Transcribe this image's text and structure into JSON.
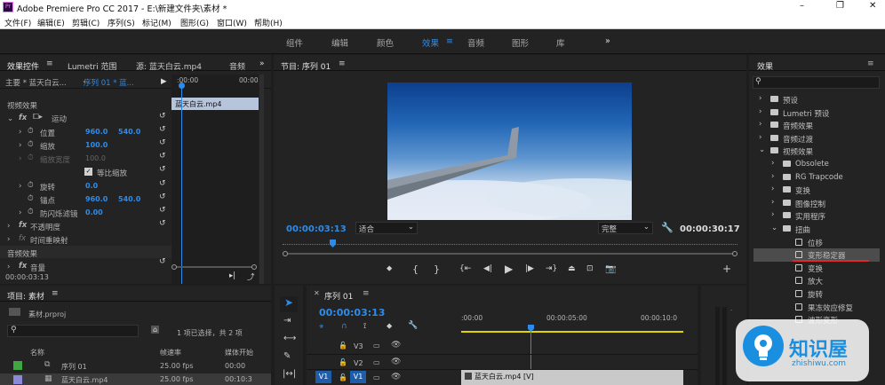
{
  "app": {
    "title": "Adobe Premiere Pro CC 2017 - E:\\新建文件夹\\素材 *"
  },
  "window_controls": {
    "minimize": "–",
    "restore": "❐",
    "close": "✕"
  },
  "menu": [
    "文件(F)",
    "编辑(E)",
    "剪辑(C)",
    "序列(S)",
    "标记(M)",
    "图形(G)",
    "窗口(W)",
    "帮助(H)"
  ],
  "workspaces": {
    "items": [
      "组件",
      "编辑",
      "颜色",
      "效果",
      "音频",
      "图形",
      "库"
    ],
    "active": "效果",
    "more": "»"
  },
  "effect_controls": {
    "tabs": [
      "效果控件",
      "Lumetri 范围",
      "源: 蓝天白云.mp4",
      "音频"
    ],
    "master": "主要 * 蓝天白云...",
    "sequence": "序列 01 * 蓝...",
    "clip_bar": "蓝天白云.mp4",
    "ruler_start": ":00:00",
    "ruler_end": "00:00",
    "video_effects": "视频效果",
    "motion": "运动",
    "position": {
      "label": "位置",
      "x": "960.0",
      "y": "540.0"
    },
    "scale": {
      "label": "缩放",
      "value": "100.0"
    },
    "scale_width": {
      "label": "缩放宽度",
      "value": "100.0"
    },
    "uniform_scale": "等比缩放",
    "rotation": {
      "label": "旋转",
      "value": "0.0"
    },
    "anchor": {
      "label": "锚点",
      "x": "960.0",
      "y": "540.0"
    },
    "antiflicker": {
      "label": "防闪烁滤镜",
      "value": "0.00"
    },
    "opacity": "不透明度",
    "time_remap": "时间重映射",
    "audio_effects": "音频效果",
    "volume": "音量",
    "timecode": "00:00:03:13"
  },
  "program": {
    "title": "节目: 序列 01",
    "timecode": "00:00:03:13",
    "fit": "适合",
    "quality": "完整",
    "duration": "00:00:30:17"
  },
  "project": {
    "title": "项目: 素材",
    "file": "素材.prproj",
    "selection": "1 项已选择，共 2 项",
    "columns": [
      "名称",
      "帧速率",
      "媒体开始"
    ],
    "items": [
      {
        "name": "序列 01",
        "fps": "25.00 fps",
        "start": "00:00",
        "color": "#3fa73f"
      },
      {
        "name": "蓝天白云.mp4",
        "fps": "25.00 fps",
        "start": "00:10:3",
        "color": "#8a8ad8"
      }
    ]
  },
  "timeline": {
    "title": "序列 01",
    "timecode": "00:00:03:13",
    "ruler": [
      ":00:00",
      "00:00:05:00",
      "00:00:10:0"
    ],
    "tracks": [
      "V3",
      "V2",
      "V1"
    ],
    "source_patch": "V1",
    "clip": "蓝天白云.mp4 [V]"
  },
  "effects_panel": {
    "title": "效果",
    "search_placeholder": "",
    "tree": [
      {
        "label": "预设",
        "indent": 0,
        "type": "folder",
        "expanded": false
      },
      {
        "label": "Lumetri 预设",
        "indent": 0,
        "type": "folder",
        "expanded": false
      },
      {
        "label": "音频效果",
        "indent": 0,
        "type": "folder",
        "expanded": false
      },
      {
        "label": "音频过渡",
        "indent": 0,
        "type": "folder",
        "expanded": false
      },
      {
        "label": "视频效果",
        "indent": 0,
        "type": "folder",
        "expanded": true
      },
      {
        "label": "Obsolete",
        "indent": 1,
        "type": "folder",
        "expanded": false
      },
      {
        "label": "RG Trapcode",
        "indent": 1,
        "type": "folder",
        "expanded": false
      },
      {
        "label": "变换",
        "indent": 1,
        "type": "folder",
        "expanded": false
      },
      {
        "label": "图像控制",
        "indent": 1,
        "type": "folder",
        "expanded": false
      },
      {
        "label": "实用程序",
        "indent": 1,
        "type": "folder",
        "expanded": false
      },
      {
        "label": "扭曲",
        "indent": 1,
        "type": "folder",
        "expanded": true
      },
      {
        "label": "位移",
        "indent": 2,
        "type": "effect"
      },
      {
        "label": "变形稳定器",
        "indent": 2,
        "type": "effect",
        "selected": true
      },
      {
        "label": "变换",
        "indent": 2,
        "type": "effect"
      },
      {
        "label": "放大",
        "indent": 2,
        "type": "effect"
      },
      {
        "label": "旋转",
        "indent": 2,
        "type": "effect"
      },
      {
        "label": "果冻效应修复",
        "indent": 2,
        "type": "effect"
      },
      {
        "label": "波形变形",
        "indent": 2,
        "type": "effect"
      }
    ]
  },
  "watermark": {
    "name": "知识屋",
    "url": "zhishiwu.com"
  },
  "colors": {
    "accent": "#2d8ceb",
    "highlight": "#4c4c4c",
    "underline": "#e0282d",
    "playhead": "#2d8ceb"
  }
}
